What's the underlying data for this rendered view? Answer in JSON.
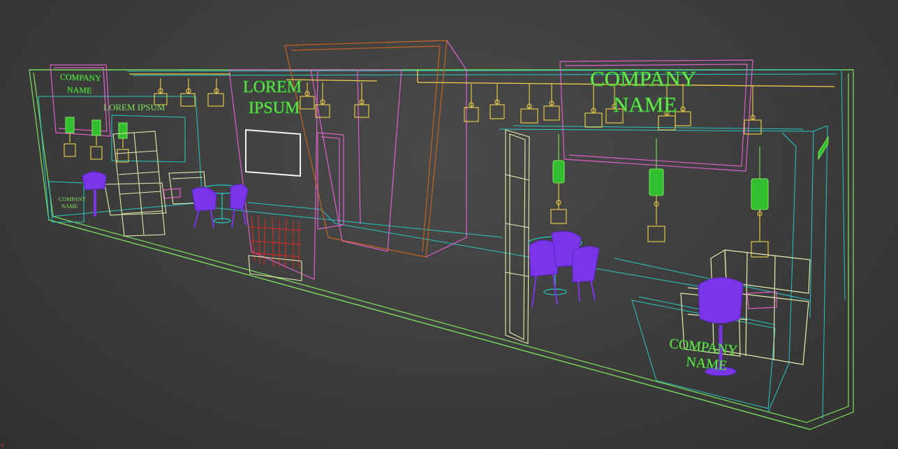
{
  "viewport": {
    "signs": {
      "left_booth_top": [
        "COMPANY",
        "NAME"
      ],
      "left_header": "LOREM IPSUM",
      "left_counter": [
        "COMPANY",
        "NAME"
      ],
      "center_wall": [
        "LOREM",
        "IPSUM"
      ],
      "right_header": [
        "COMPANY",
        "NAME"
      ],
      "right_counter": [
        "COMPANY",
        "NAME"
      ]
    },
    "axis_marker": "x"
  },
  "colors": {
    "background": "#3c3c3c",
    "cyan_wire": "#27c7c3",
    "green_wire": "#7ee25a",
    "yellow_wire": "#f0d24a",
    "pink_wire": "#e060c8",
    "orange_wire": "#c8621e",
    "purple_chairs": "#7a35e8",
    "cream_sofa": "#e9eeb0",
    "red_plant": "#d42a2a",
    "white_screen": "#f4f4f4",
    "green_lamp": "#2fbf2f"
  }
}
